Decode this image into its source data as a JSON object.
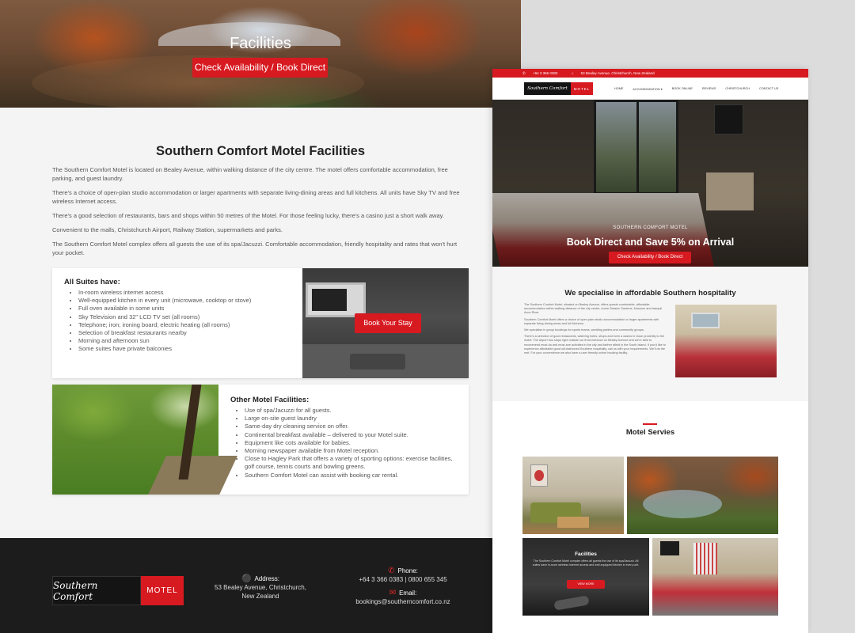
{
  "left_page": {
    "hero": {
      "title": "Facilities",
      "cta_label": "Check Availability / Book Direct"
    },
    "intro": {
      "heading": "Southern Comfort Motel Facilities",
      "paragraphs": [
        "The Southern Comfort Motel is located on Bealey Avenue, within walking distance of the city centre. The motel offers comfortable accommodation, free parking, and guest laundry.",
        "There's a choice of open-plan studio accommodation or larger apartments with separate living-dining areas and full kitchens. All units have Sky TV and free wireless Internet access.",
        "There's a good selection of restaurants, bars and shops within 50 metres of the Motel. For those feeling lucky, there's a casino just a short walk away.",
        "Convenient to the malls, Christchurch Airport, Railway Station, supermarkets and parks.",
        "The Southern Comfort Motel complex offers all guests the use of its spa/Jacuzzi. Comfortable accommodation, friendly hospitality and rates that won't hurt your pocket."
      ]
    },
    "suites": {
      "heading": "All Suites have:",
      "items": [
        "In-room wireless internet access",
        "Well-equipped kitchen in every unit (microwave, cooktop or stove)",
        "Full oven available in some units",
        "Sky Television and 32\" LCD TV set (all rooms)",
        "Telephone; iron; ironing board; electric heating (all rooms)",
        "Selection of breakfast restaurants nearby",
        "Morning and afternoon sun",
        "Some suites have private balconies"
      ],
      "button_label": "Book Your Stay"
    },
    "other": {
      "heading": "Other Motel Facilities:",
      "items": [
        "Use of spa/Jacuzzi for all guests.",
        "Large on-site guest laundry",
        "Same-day dry cleaning service on offer.",
        "Continental breakfast available – delivered to your Motel suite.",
        "Equipment like cots available for babies.",
        "Morning newspaper available from Motel reception.",
        "Close to Hagley Park that offers a variety of sporting options: exercise facilities, golf course, tennis courts and bowling greens.",
        "Southern Comfort Motel can assist with booking car rental."
      ]
    },
    "footer": {
      "logo_script": "Southern Comfort",
      "logo_badge": "MOTEL",
      "address_label": "Address:",
      "address_line1": "53 Bealey Avenue, Christchurch,",
      "address_line2": "New Zealand",
      "phone_label": "Phone:",
      "phone_value": "+64 3 366 0383 | 0800 655 345",
      "email_label": "Email:",
      "email_value": "bookings@southerncomfort.co.nz"
    }
  },
  "right_page": {
    "topbar": {
      "phone": "+64 3 366 0383",
      "address": "53 Bealey Avenue, Christchurch, New Zealand"
    },
    "logo_script": "Southern Comfort",
    "logo_badge": "MOTEL",
    "nav": [
      "HOME",
      "ACCOMMODATION ▾",
      "BOOK ONLINE",
      "REVIEWS",
      "CHRISTCHURCH",
      "CONTACT US"
    ],
    "hero": {
      "kicker": "SOUTHERN COMFORT MOTEL",
      "headline": "Book Direct and Save 5% on Arrival",
      "cta_label": "Check Availability / Book Direct"
    },
    "specialise": {
      "heading": "We specialise in affordable Southern hospitality",
      "paragraphs": [
        "The Southern Comfort Motel, situated on Bealey Avenue, offers guests comfortable, affordable accommodation within walking distance of the city centre, iconic Botanic Gardens, Museum and tranquil Avon River.",
        "Southern Comfort Motel offers a choice of open-plan studio accommodation or larger apartments with separate living-dining areas and full kitchens.",
        "We specialise in group bookings for sports teams, wedding parties and community groups.",
        "There's a selection of good restaurants, watering holes, shops and even a casino in close proximity to the motel. The airport bus stops right outside our front entrance on Bealey Avenue and we're able to recommend must-do and must-see activities in the city and farther afield in the South Island. If you'd like to experience affordable good old-fashioned Southern hospitality, call us with your requirements. We'll do the rest. For your convenience we also have a user friendly online booking facility."
      ]
    },
    "services": {
      "heading": "Motel Servies",
      "facilities_tile": {
        "title": "Facilities",
        "text": "The Southern Comfort Motel complex offers all guests the use of its spa/Jacuzzi. All suites have in-room wireless internet access and well-equipped kitchen in every unit.",
        "button_label": "VIEW MORE"
      }
    }
  },
  "colors": {
    "brand_red": "#d71920",
    "footer_bg": "#1c1c1c",
    "page_bg": "#f4f4f4"
  }
}
